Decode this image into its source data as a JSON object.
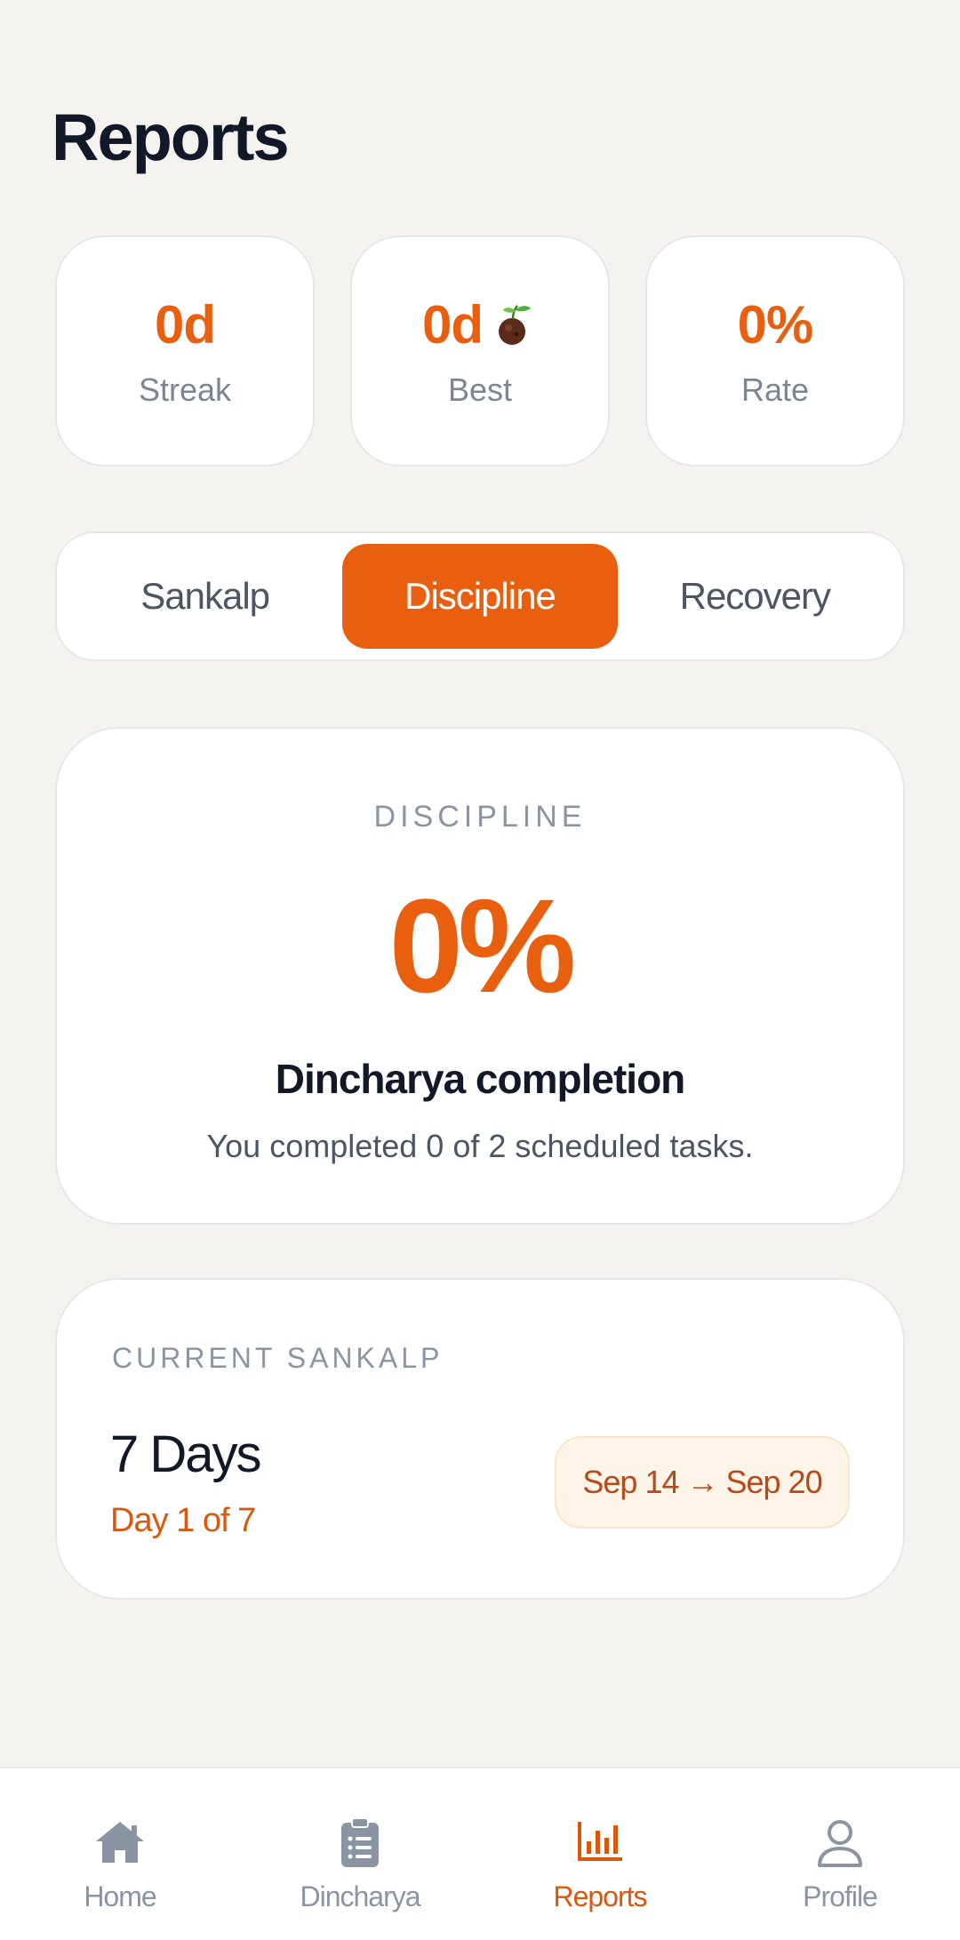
{
  "header": {
    "title": "Reports"
  },
  "stats": [
    {
      "value": "0d",
      "label": "Streak",
      "icon": null
    },
    {
      "value": "0d",
      "label": "Best",
      "icon": "seedling-icon"
    },
    {
      "value": "0%",
      "label": "Rate",
      "icon": null
    }
  ],
  "tabs": [
    {
      "label": "Sankalp",
      "active": false
    },
    {
      "label": "Discipline",
      "active": true
    },
    {
      "label": "Recovery",
      "active": false
    }
  ],
  "discipline": {
    "eyebrow": "DISCIPLINE",
    "value": "0%",
    "heading": "Dincharya completion",
    "subtext": "You completed 0 of 2 scheduled tasks."
  },
  "sankalp": {
    "eyebrow": "CURRENT SANKALP",
    "duration": "7 Days",
    "progress": "Day 1 of 7",
    "date_range": "Sep 14 → Sep 20"
  },
  "nav": [
    {
      "label": "Home",
      "icon": "home-icon",
      "active": false
    },
    {
      "label": "Dincharya",
      "icon": "clipboard-list-icon",
      "active": false
    },
    {
      "label": "Reports",
      "icon": "bar-chart-icon",
      "active": true
    },
    {
      "label": "Profile",
      "icon": "user-icon",
      "active": false
    }
  ],
  "colors": {
    "accent": "#e8600f",
    "muted": "#8a94a3",
    "background": "#f5f3f0"
  }
}
